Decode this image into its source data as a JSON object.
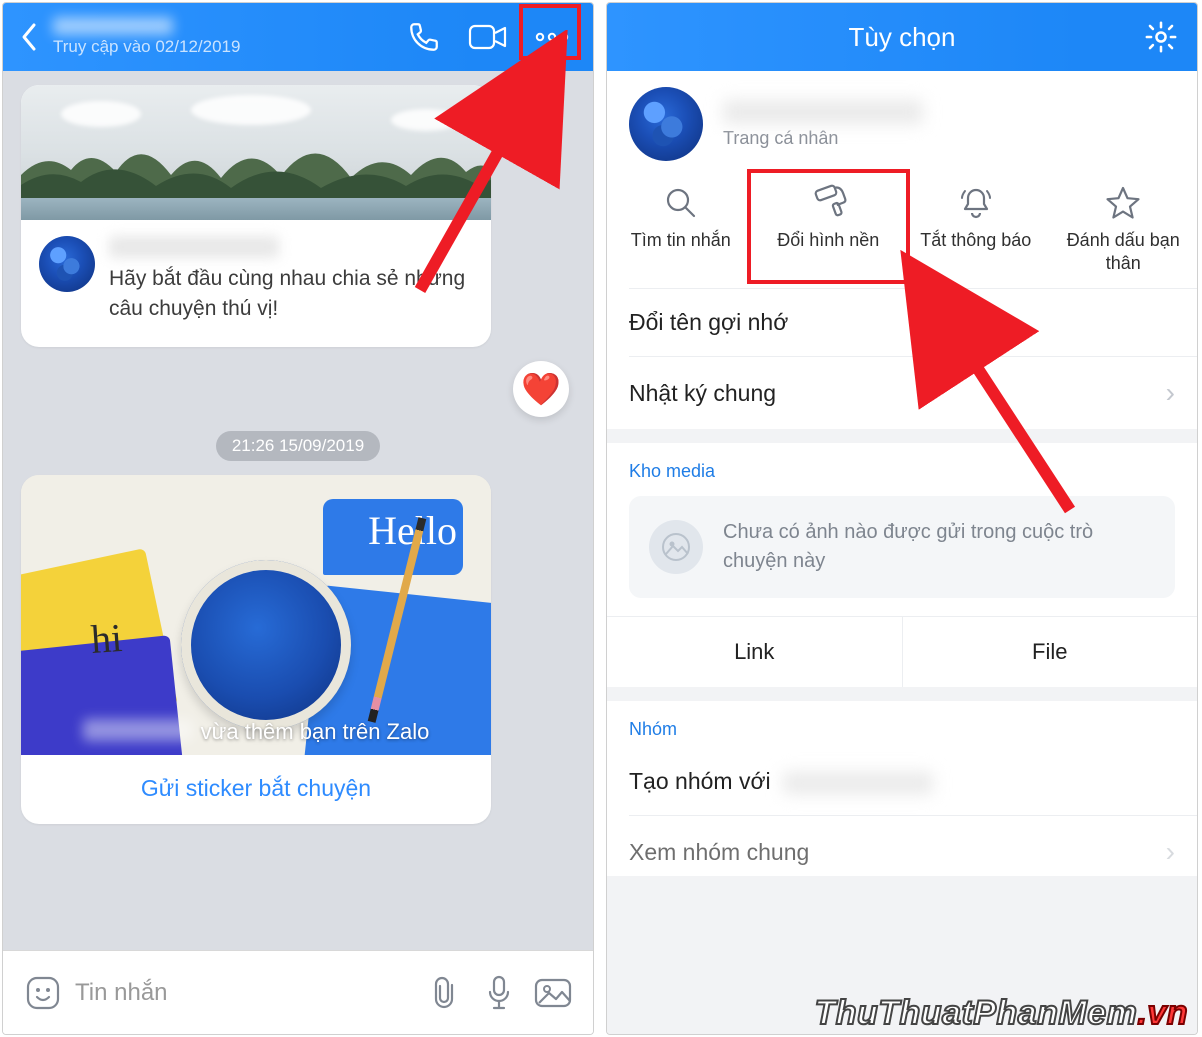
{
  "colors": {
    "brand": "#2e94ff",
    "accent_red": "#ee1c25",
    "link_blue": "#2e8bff"
  },
  "left": {
    "subtitle": "Truy cập vào 02/12/2019",
    "card_intro_text": "Hãy bắt đầu cùng nhau chia sẻ những câu chuyện thú vị!",
    "heart_emoji": "❤️",
    "timestamp": "21:26 15/09/2019",
    "hello_word": "Hello",
    "hi_word": "hi",
    "added_caption": "vừa thêm bạn trên Zalo",
    "sticker_button": "Gửi sticker bắt chuyện",
    "composer_placeholder": "Tin nhắn"
  },
  "right": {
    "title": "Tùy chọn",
    "profile_sub": "Trang cá nhân",
    "quick": {
      "search": "Tìm tin nhắn",
      "background": "Đổi hình nền",
      "mute": "Tắt thông báo",
      "favorite": "Đánh dấu bạn thân"
    },
    "rename": "Đổi tên gợi nhớ",
    "shared_diary": "Nhật ký chung",
    "media_label": "Kho media",
    "media_empty": "Chưa có ảnh nào được gửi trong cuộc trò chuyện này",
    "link_tab": "Link",
    "file_tab": "File",
    "group_label": "Nhóm",
    "create_group": "Tạo nhóm với",
    "view_groups": "Xem nhóm chung"
  },
  "watermark": {
    "part1": "ThuThuatPhanMem",
    "part2": ".vn"
  }
}
